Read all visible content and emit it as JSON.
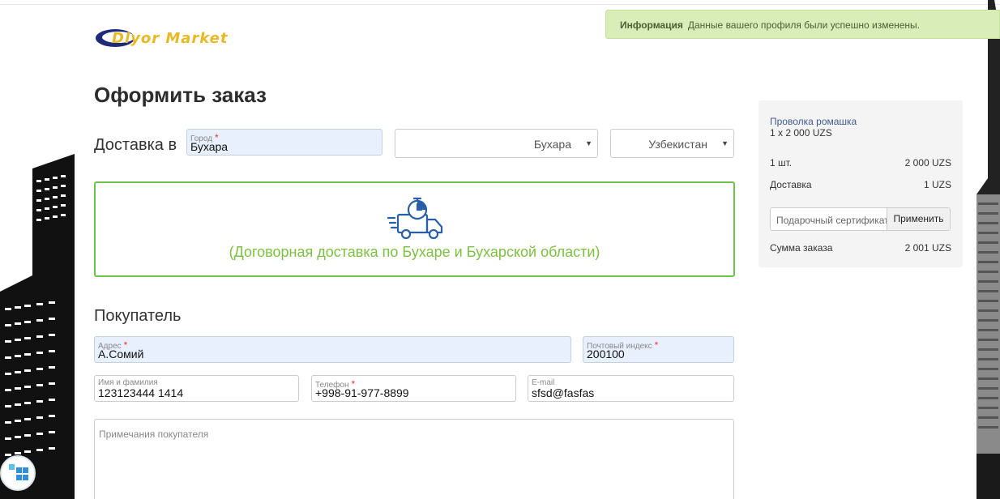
{
  "logo": {
    "text": "Dlyor Market"
  },
  "notice": {
    "title": "Информация",
    "message": "Данные вашего профиля были успешно изменены."
  },
  "page": {
    "title": "Оформить заказ"
  },
  "delivery": {
    "label": "Доставка в",
    "city_field": {
      "label": "Город",
      "required": "*",
      "value": "Бухара"
    },
    "region_select": {
      "value": "Бухара"
    },
    "country_select": {
      "value": "Узбекистан"
    },
    "option_text": "(Договорная доставка по Бухаре и Бухарской области)"
  },
  "buyer": {
    "title": "Покупатель",
    "address": {
      "label": "Адрес",
      "required": "*",
      "value": "А.Сомий"
    },
    "postcode": {
      "label": "Почтовый индекс",
      "required": "*",
      "value": "200100"
    },
    "name": {
      "label": "Имя и фамилия",
      "value": "123123444 1414"
    },
    "phone": {
      "label": "Телефон",
      "required": "*",
      "value": "+998-91-977-8899"
    },
    "email": {
      "label": "E-mail",
      "value": "sfsd@fasfas"
    },
    "notes_placeholder": "Примечания покупателя"
  },
  "summary": {
    "product_name": "Проволка ромашка",
    "product_qty": "1 x 2 000 UZS",
    "items_label": "1 шт.",
    "items_value": "2 000 UZS",
    "delivery_label": "Доставка",
    "delivery_value": "1 UZS",
    "coupon_placeholder": "Подарочный сертификат",
    "coupon_button": "Применить",
    "total_label": "Сумма заказа",
    "total_value": "2 001 UZS"
  },
  "colors": {
    "accent_green": "#6cc24a",
    "notice_bg": "#d9edb9",
    "logo_yellow": "#e8b923",
    "link_blue": "#3f5d8f"
  }
}
